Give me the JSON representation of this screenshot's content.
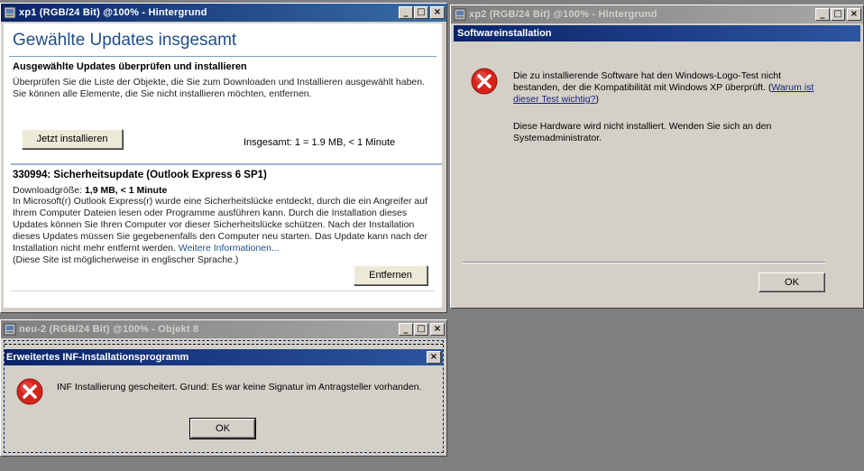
{
  "windows": {
    "xp1": {
      "title": "xp1 (RGB/24 Bit) @100% - Hintergrund",
      "heading": "Gewählte Updates insgesamt",
      "subheading": "Ausgewählte Updates überprüfen und installieren",
      "description": "Überprüfen Sie die Liste der Objekte, die Sie zum Downloaden und Installieren ausgewählt haben. Sie können alle Elemente, die Sie nicht installieren möchten, entfernen.",
      "install_button": "Jetzt installieren",
      "total": "Insgesamt: 1 = 1.9 MB, < 1 Minute",
      "update": {
        "title": "330994: Sicherheitsupdate (Outlook Express 6 SP1)",
        "size_label": "Downloadgröße: ",
        "size_value": "1,9 MB, < 1 Minute",
        "body": "In Microsoft(r) Outlook Express(r) wurde eine Sicherheitslücke entdeckt, durch die ein Angreifer auf Ihrem Computer Dateien lesen oder Programme ausführen kann. Durch die Installation dieses Updates können Sie Ihren Computer vor dieser Sicherheitslücke schützen. Nach der Installation dieses Updates müssen Sie gegebenenfalls den Computer neu starten. Das Update kann nach der Installation nicht mehr entfernt werden. ",
        "more_link": "Weitere Informationen...",
        "english_note": "(Diese Site ist möglicherweise in englischer Sprache.)",
        "remove_button": "Entfernen"
      }
    },
    "xp2": {
      "title": "xp2 (RGB/24 Bit) @100% - Hintergrund",
      "dialog_title": "Softwareinstallation",
      "message1": "Die zu installierende Software hat den Windows-Logo-Test nicht bestanden, der die Kompatibilität mit Windows XP überprüft. (",
      "message1_link": "Warum ist dieser Test wichtig?",
      "message1_end": ")",
      "message2": "Diese Hardware wird nicht installiert. Wenden Sie sich an den Systemadministrator.",
      "ok_button": "OK"
    },
    "neu2": {
      "title": "neu-2 (RGB/24 Bit) @100% - Objekt 8",
      "dialog_title": "Erweitertes INF-Installationsprogramm",
      "message": "INF Installierung gescheitert. Grund: Es war keine Signatur im Antragsteller vorhanden.",
      "ok_button": "OK"
    }
  },
  "controls": {
    "minimize": "_",
    "maximize": "□",
    "close": "×"
  },
  "icons": {
    "document": "photoshop-document-icon",
    "error": "error-x-icon"
  },
  "colors": {
    "active_title": "#0a246a",
    "inactive_title": "#808080",
    "error_red": "#d8231a",
    "workspace": "#808080"
  }
}
